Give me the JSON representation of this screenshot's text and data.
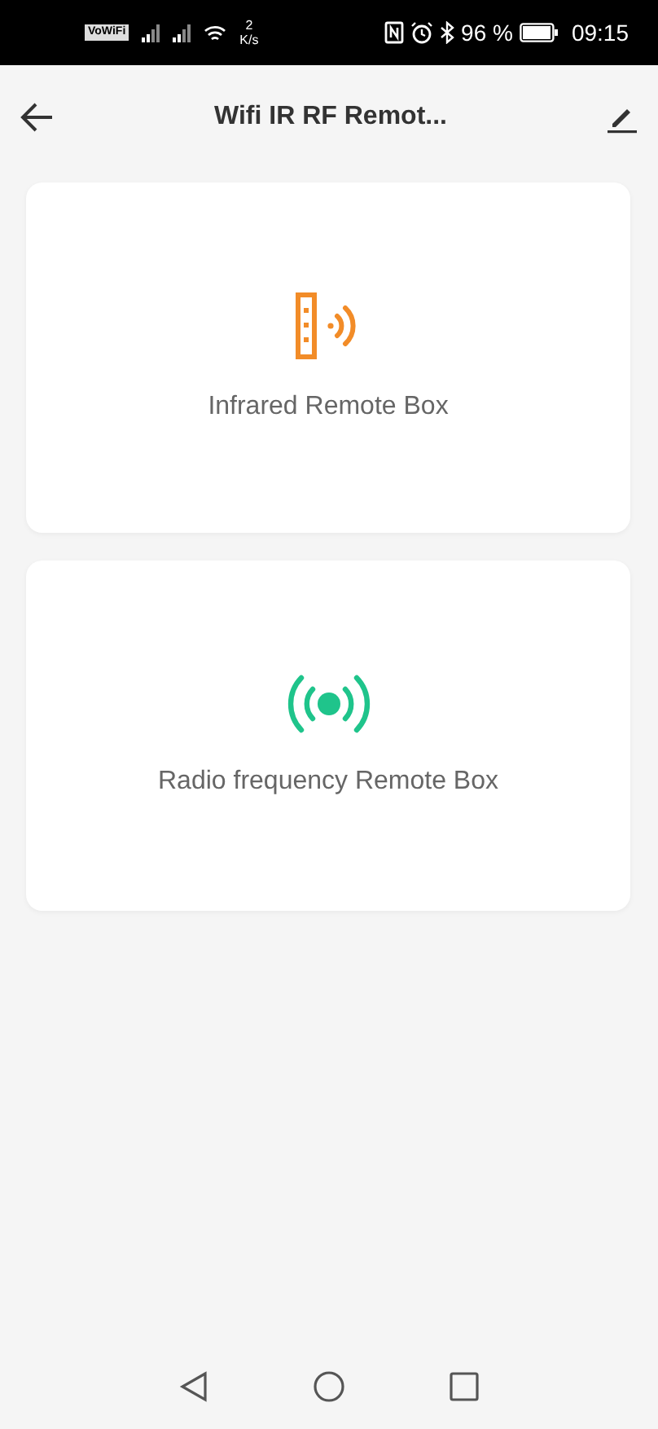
{
  "status_bar": {
    "vowifi": "VoWiFi",
    "speed_value": "2",
    "speed_unit": "K/s",
    "battery": "96 %",
    "time": "09:15"
  },
  "header": {
    "title": "Wifi IR RF Remot..."
  },
  "devices": [
    {
      "kind": "infrared",
      "label": "Infrared Remote Box"
    },
    {
      "kind": "radio",
      "label": "Radio frequency Remote Box"
    }
  ]
}
